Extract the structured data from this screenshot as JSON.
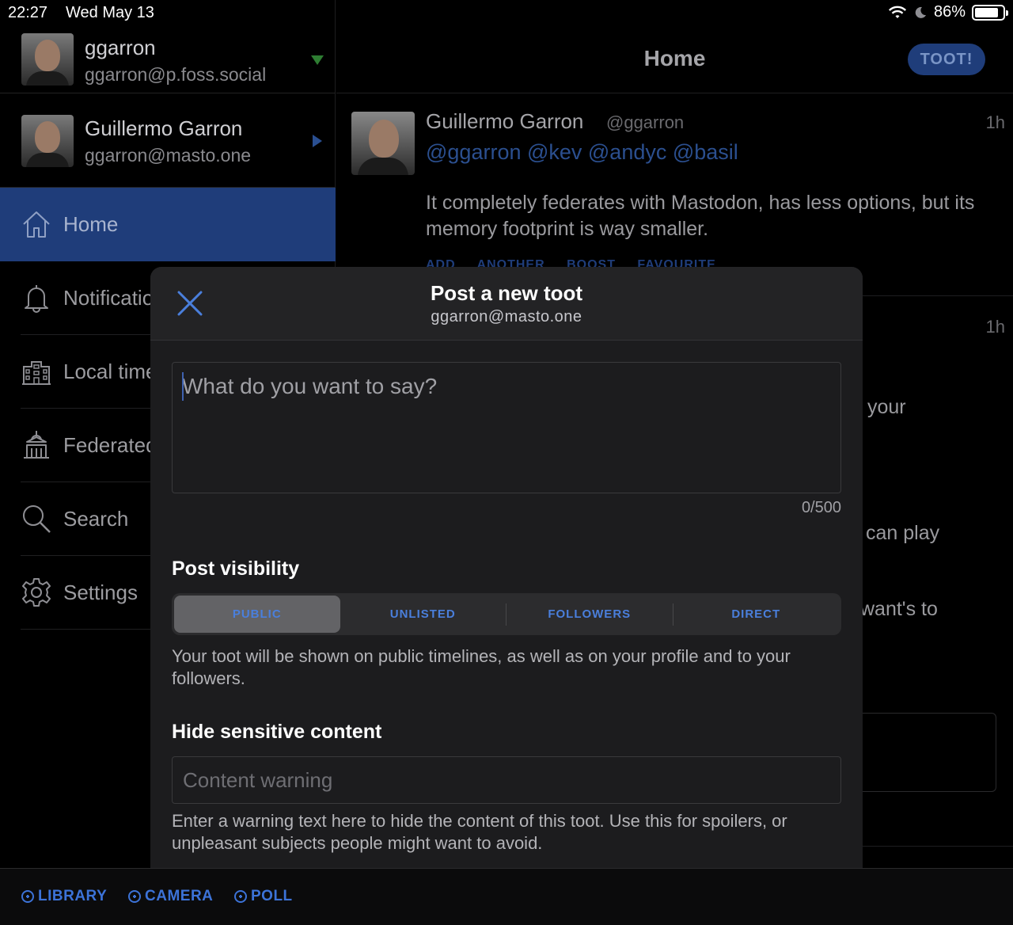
{
  "status_bar": {
    "time": "22:27",
    "date": "Wed May 13",
    "battery": "86%",
    "battery_level": 0.86
  },
  "sidebar": {
    "accounts": [
      {
        "name": "ggarron",
        "handle": "ggarron@p.foss.social",
        "indicator": "chevron-down-icon"
      },
      {
        "name": "Guillermo Garron",
        "handle": "ggarron@masto.one",
        "indicator": "chevron-right-icon"
      }
    ],
    "items": [
      {
        "label": "Home",
        "icon": "home-icon",
        "active": true
      },
      {
        "label": "Notifications",
        "icon": "bell-icon"
      },
      {
        "label": "Local timeline",
        "icon": "building-icon"
      },
      {
        "label": "Federated",
        "icon": "landmark-icon"
      },
      {
        "label": "Search",
        "icon": "search-icon"
      },
      {
        "label": "Settings",
        "icon": "gear-icon"
      }
    ]
  },
  "main": {
    "title": "Home",
    "toot_button": "TOOT!",
    "post": {
      "name": "Guillermo Garron",
      "acct": "@ggarron",
      "time": "1h",
      "mentions": "@ggarron @kev @andyc @basil",
      "body": "It completely federates with Mastodon, has less options, but its memory footprint is way smaller.",
      "actions": "ADD ANOTHER BOOST FAVOURITE"
    },
    "second_post_time": "1h",
    "fragments": [
      "your",
      "can play",
      "want's to"
    ]
  },
  "modal": {
    "title": "Post a new toot",
    "subtitle": "ggarron@masto.one",
    "compose_placeholder": "What do you want to say?",
    "counter": "0/500",
    "visibility_label": "Post visibility",
    "visibility_options": [
      "PUBLIC",
      "UNLISTED",
      "FOLLOWERS",
      "DIRECT"
    ],
    "visibility_selected": "PUBLIC",
    "visibility_help": "Your toot will be shown on public timelines, as well as on your profile and to your followers.",
    "sensitive_label": "Hide sensitive content",
    "cw_placeholder": "Content warning",
    "cw_help": "Enter a warning text here to hide the content of this toot. Use this for spoilers, or unpleasant subjects people might want to avoid."
  },
  "toolbar": {
    "library": "LIBRARY",
    "camera": "CAMERA",
    "poll": "POLL"
  },
  "colors": {
    "accent": "#3c73d8",
    "active_nav": "#1f3d7a",
    "modal_bg": "#1c1c1e"
  }
}
